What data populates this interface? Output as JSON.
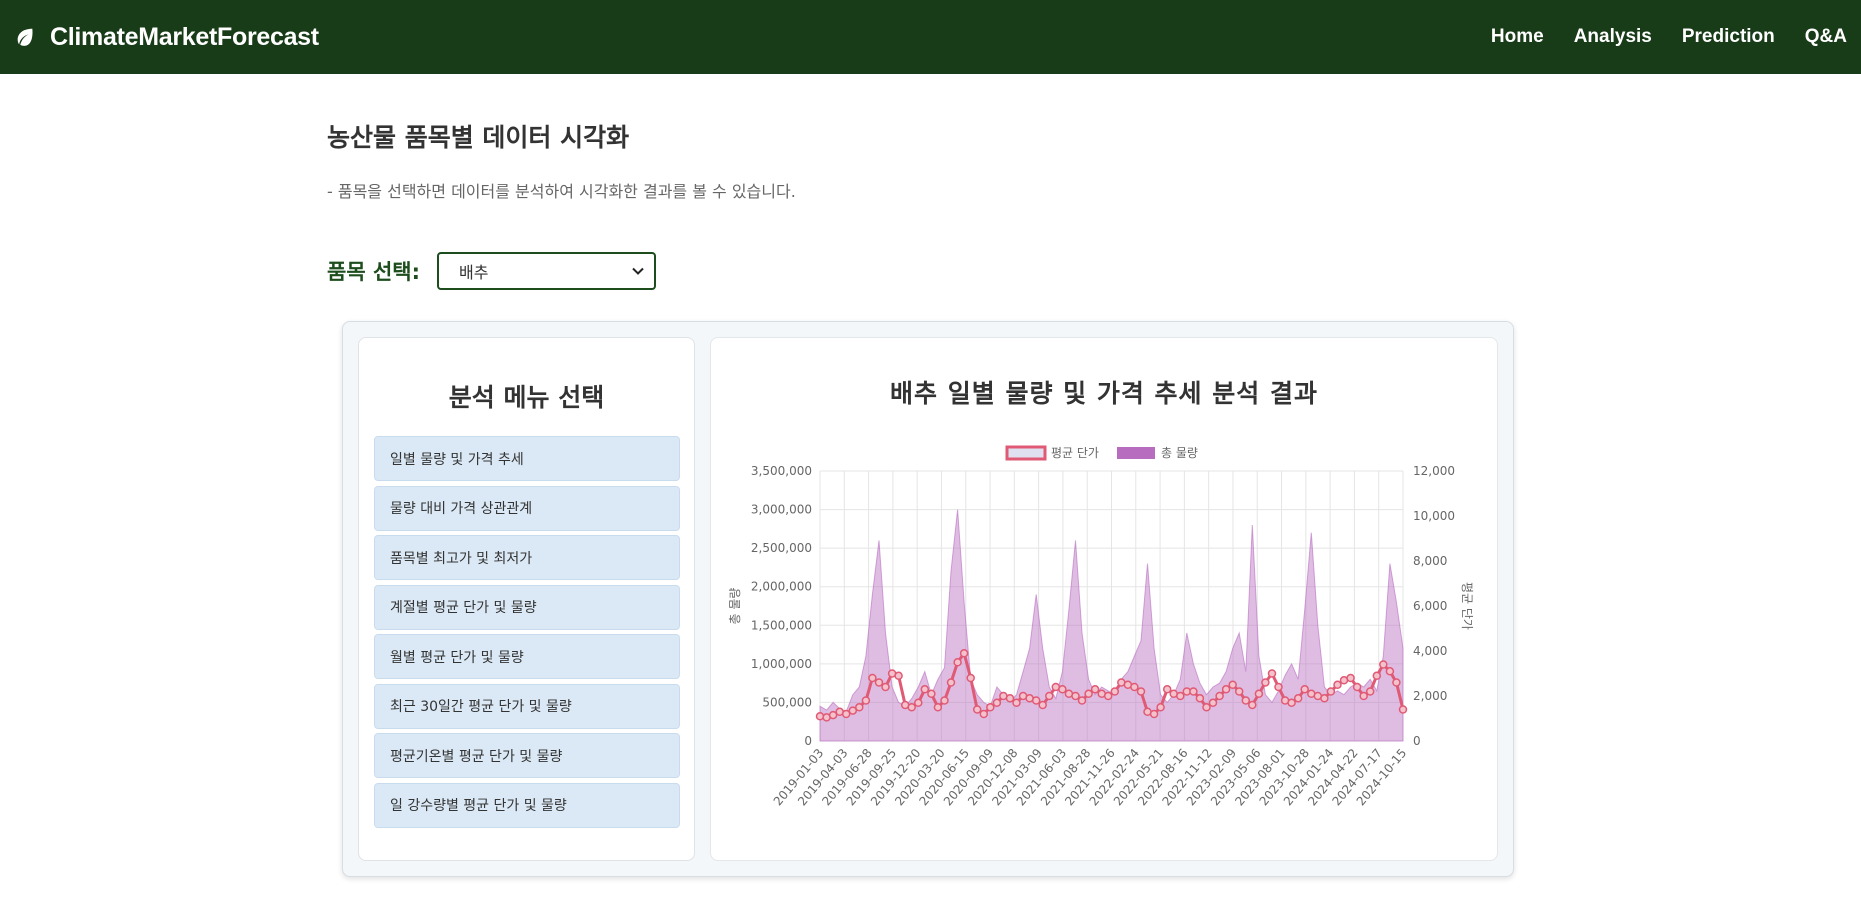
{
  "nav": {
    "brand": "ClimateMarketForecast",
    "links": [
      "Home",
      "Analysis",
      "Prediction",
      "Q&A"
    ]
  },
  "page": {
    "title": "농산물 품목별 데이터 시각화",
    "description": "- 품목을 선택하면 데이터를 분석하여 시각화한 결과를 볼 수 있습니다."
  },
  "selector": {
    "label": "품목 선택:",
    "value": "배추"
  },
  "menu": {
    "title": "분석 메뉴 선택",
    "items": [
      "일별 물량 및 가격 추세",
      "물량 대비 가격 상관관계",
      "품목별 최고가 및 최저가",
      "계절별 평균 단가 및 물량",
      "월별 평균 단가 및 물량",
      "최근 30일간 평균 단가 및 물량",
      "평균기온별 평균 단가 및 물량",
      "일 강수량별 평균 단가 및 물량"
    ]
  },
  "chart_data": {
    "type": "line",
    "title": "배추 일별 물량 및 가격 추세 분석 결과",
    "legend_position": "top",
    "grid": true,
    "ylabel_left": "총 물량",
    "ylabel_right": "평균 단가",
    "ylim_left": [
      0,
      3500000
    ],
    "yticks_left": [
      "0",
      "500,000",
      "1,000,000",
      "1,500,000",
      "2,000,000",
      "2,500,000",
      "3,000,000",
      "3,500,000"
    ],
    "ylim_right": [
      0,
      12000
    ],
    "yticks_right": [
      "0",
      "2,000",
      "4,000",
      "6,000",
      "8,000",
      "10,000",
      "12,000"
    ],
    "x_tick_labels": [
      "2019-01-03",
      "2019-04-03",
      "2019-06-28",
      "2019-09-25",
      "2019-12-20",
      "2020-03-20",
      "2020-06-15",
      "2020-09-09",
      "2020-12-08",
      "2021-03-09",
      "2021-06-03",
      "2021-08-28",
      "2021-11-26",
      "2022-02-24",
      "2022-05-21",
      "2022-08-16",
      "2022-11-12",
      "2023-02-09",
      "2023-05-06",
      "2023-08-01",
      "2023-10-28",
      "2024-01-24",
      "2024-04-22",
      "2024-07-17",
      "2024-10-15"
    ],
    "series": [
      {
        "name": "평균 단가",
        "axis": "right",
        "render": "line",
        "color": "#e05a75",
        "values": [
          1100,
          1050,
          1150,
          1300,
          1200,
          1350,
          1500,
          1800,
          2800,
          2600,
          2400,
          3000,
          2900,
          1600,
          1500,
          1700,
          2300,
          2100,
          1500,
          1800,
          2600,
          3500,
          3900,
          2800,
          1400,
          1200,
          1500,
          1700,
          2000,
          1900,
          1700,
          2000,
          1900,
          1800,
          1600,
          2000,
          2400,
          2300,
          2100,
          2000,
          1800,
          2100,
          2300,
          2100,
          2000,
          2200,
          2600,
          2500,
          2400,
          2200,
          1300,
          1200,
          1500,
          2300,
          2100,
          2000,
          2200,
          2200,
          1900,
          1500,
          1700,
          2000,
          2300,
          2500,
          2200,
          1800,
          1600,
          2100,
          2600,
          3000,
          2400,
          1800,
          1700,
          1900,
          2300,
          2100,
          2000,
          1900,
          2200,
          2500,
          2700,
          2800,
          2400,
          2000,
          2200,
          2900,
          3400,
          3100,
          2600,
          1400
        ]
      },
      {
        "name": "총 물량",
        "axis": "left",
        "render": "area",
        "color": "#b86cc0",
        "values": [
          450000,
          400000,
          500000,
          420000,
          380000,
          600000,
          700000,
          1100000,
          1900000,
          2600000,
          1400000,
          700000,
          500000,
          450000,
          550000,
          700000,
          900000,
          600000,
          800000,
          950000,
          2200000,
          3000000,
          1800000,
          800000,
          600000,
          500000,
          450000,
          700000,
          600000,
          500000,
          600000,
          900000,
          1200000,
          1900000,
          1200000,
          700000,
          550000,
          900000,
          1700000,
          2600000,
          1400000,
          800000,
          600000,
          700000,
          650000,
          600000,
          800000,
          900000,
          1100000,
          1300000,
          2300000,
          1200000,
          600000,
          500000,
          600000,
          800000,
          1400000,
          1000000,
          750000,
          600000,
          700000,
          750000,
          900000,
          1200000,
          1400000,
          900000,
          2800000,
          1100000,
          600000,
          500000,
          650000,
          850000,
          1000000,
          800000,
          1700000,
          2700000,
          1500000,
          700000,
          600000,
          650000,
          600000,
          700000,
          750000,
          700000,
          800000,
          650000,
          1100000,
          2300000,
          1800000,
          1200000
        ]
      }
    ]
  }
}
